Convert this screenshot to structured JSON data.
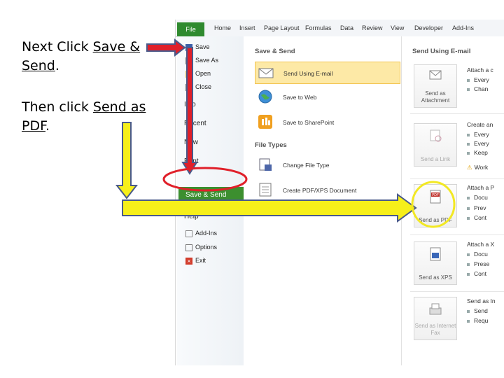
{
  "instructions": {
    "step1_prefix": "Next Click ",
    "step1_link": "Save & Send",
    "step1_suffix": ".",
    "step2_prefix": "Then click ",
    "step2_link": "Send as PDF",
    "step2_suffix": "."
  },
  "ribbon": {
    "file_tab": "File",
    "tabs": [
      "Home",
      "Insert",
      "Page Layout",
      "Formulas",
      "Data",
      "Review",
      "View",
      "Developer",
      "Add-Ins"
    ]
  },
  "backstage_menu": {
    "items": [
      "Save",
      "Save As",
      "Open",
      "Close",
      "Info",
      "Recent",
      "New",
      "Print",
      "Save & Send",
      "Help",
      "Add-Ins",
      "Options",
      "Exit"
    ],
    "selected": "Save & Send"
  },
  "save_send": {
    "heading": "Save & Send",
    "items": [
      "Send Using E-mail",
      "Save to Web",
      "Save to SharePoint"
    ],
    "file_types_heading": "File Types",
    "file_type_items": [
      "Change File Type",
      "Create PDF/XPS Document"
    ]
  },
  "send_email": {
    "heading": "Send Using E-mail",
    "buttons": [
      "Send as Attachment",
      "Send a Link",
      "Send as PDF",
      "Send as XPS",
      "Send as Internet Fax"
    ],
    "descriptions": [
      [
        "Attach a c",
        "Every",
        "Chan"
      ],
      [
        "Create an",
        "Every",
        "Every",
        "Keep",
        "Work"
      ],
      [
        "Attach a P",
        "Docu",
        "Prev",
        "Cont"
      ],
      [
        "Attach a X",
        "Docu",
        "Prese",
        "Cont"
      ],
      [
        "Send as In",
        "Send",
        "Requ"
      ]
    ]
  },
  "colors": {
    "arrow_red": "#e0202a",
    "arrow_yellow": "#f6ef1a",
    "arrow_outline": "#4a5a8a",
    "highlight_yellow": "#f2e824",
    "file_green": "#2f8a2f"
  }
}
